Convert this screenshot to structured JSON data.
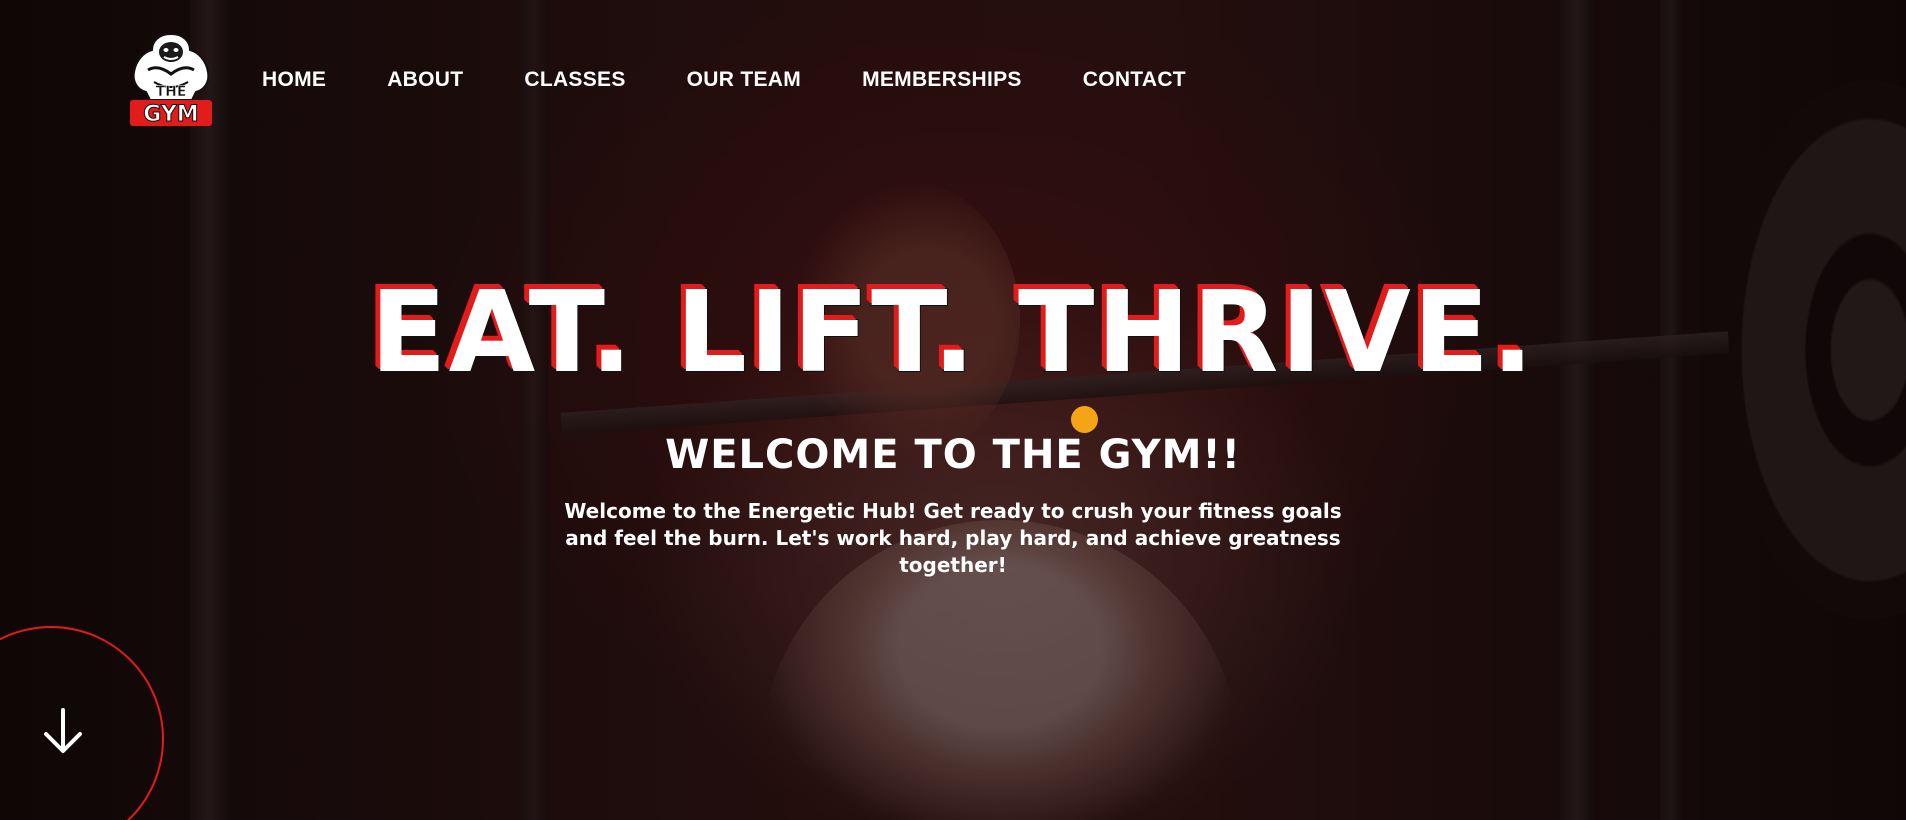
{
  "logo": {
    "text_top": "THE",
    "text_bottom": "GYM",
    "icon": "gorilla-mascot-icon"
  },
  "nav": {
    "items": [
      "HOME",
      "ABOUT",
      "CLASSES",
      "OUR TEAM",
      "MEMBERSHIPS",
      "CONTACT"
    ]
  },
  "hero": {
    "headline": "EAT. LIFT. THRIVE.",
    "welcome_title": "WELCOME TO THE GYM!!",
    "welcome_text": "Welcome to the Energetic Hub! Get ready to crush your fitness goals and feel the burn. Let's work hard, play hard, and achieve greatness together!",
    "scroll_icon": "arrow-down-icon"
  },
  "colors": {
    "accent": "#e21b1b",
    "dot": "#f5a317",
    "text": "#ffffff"
  }
}
